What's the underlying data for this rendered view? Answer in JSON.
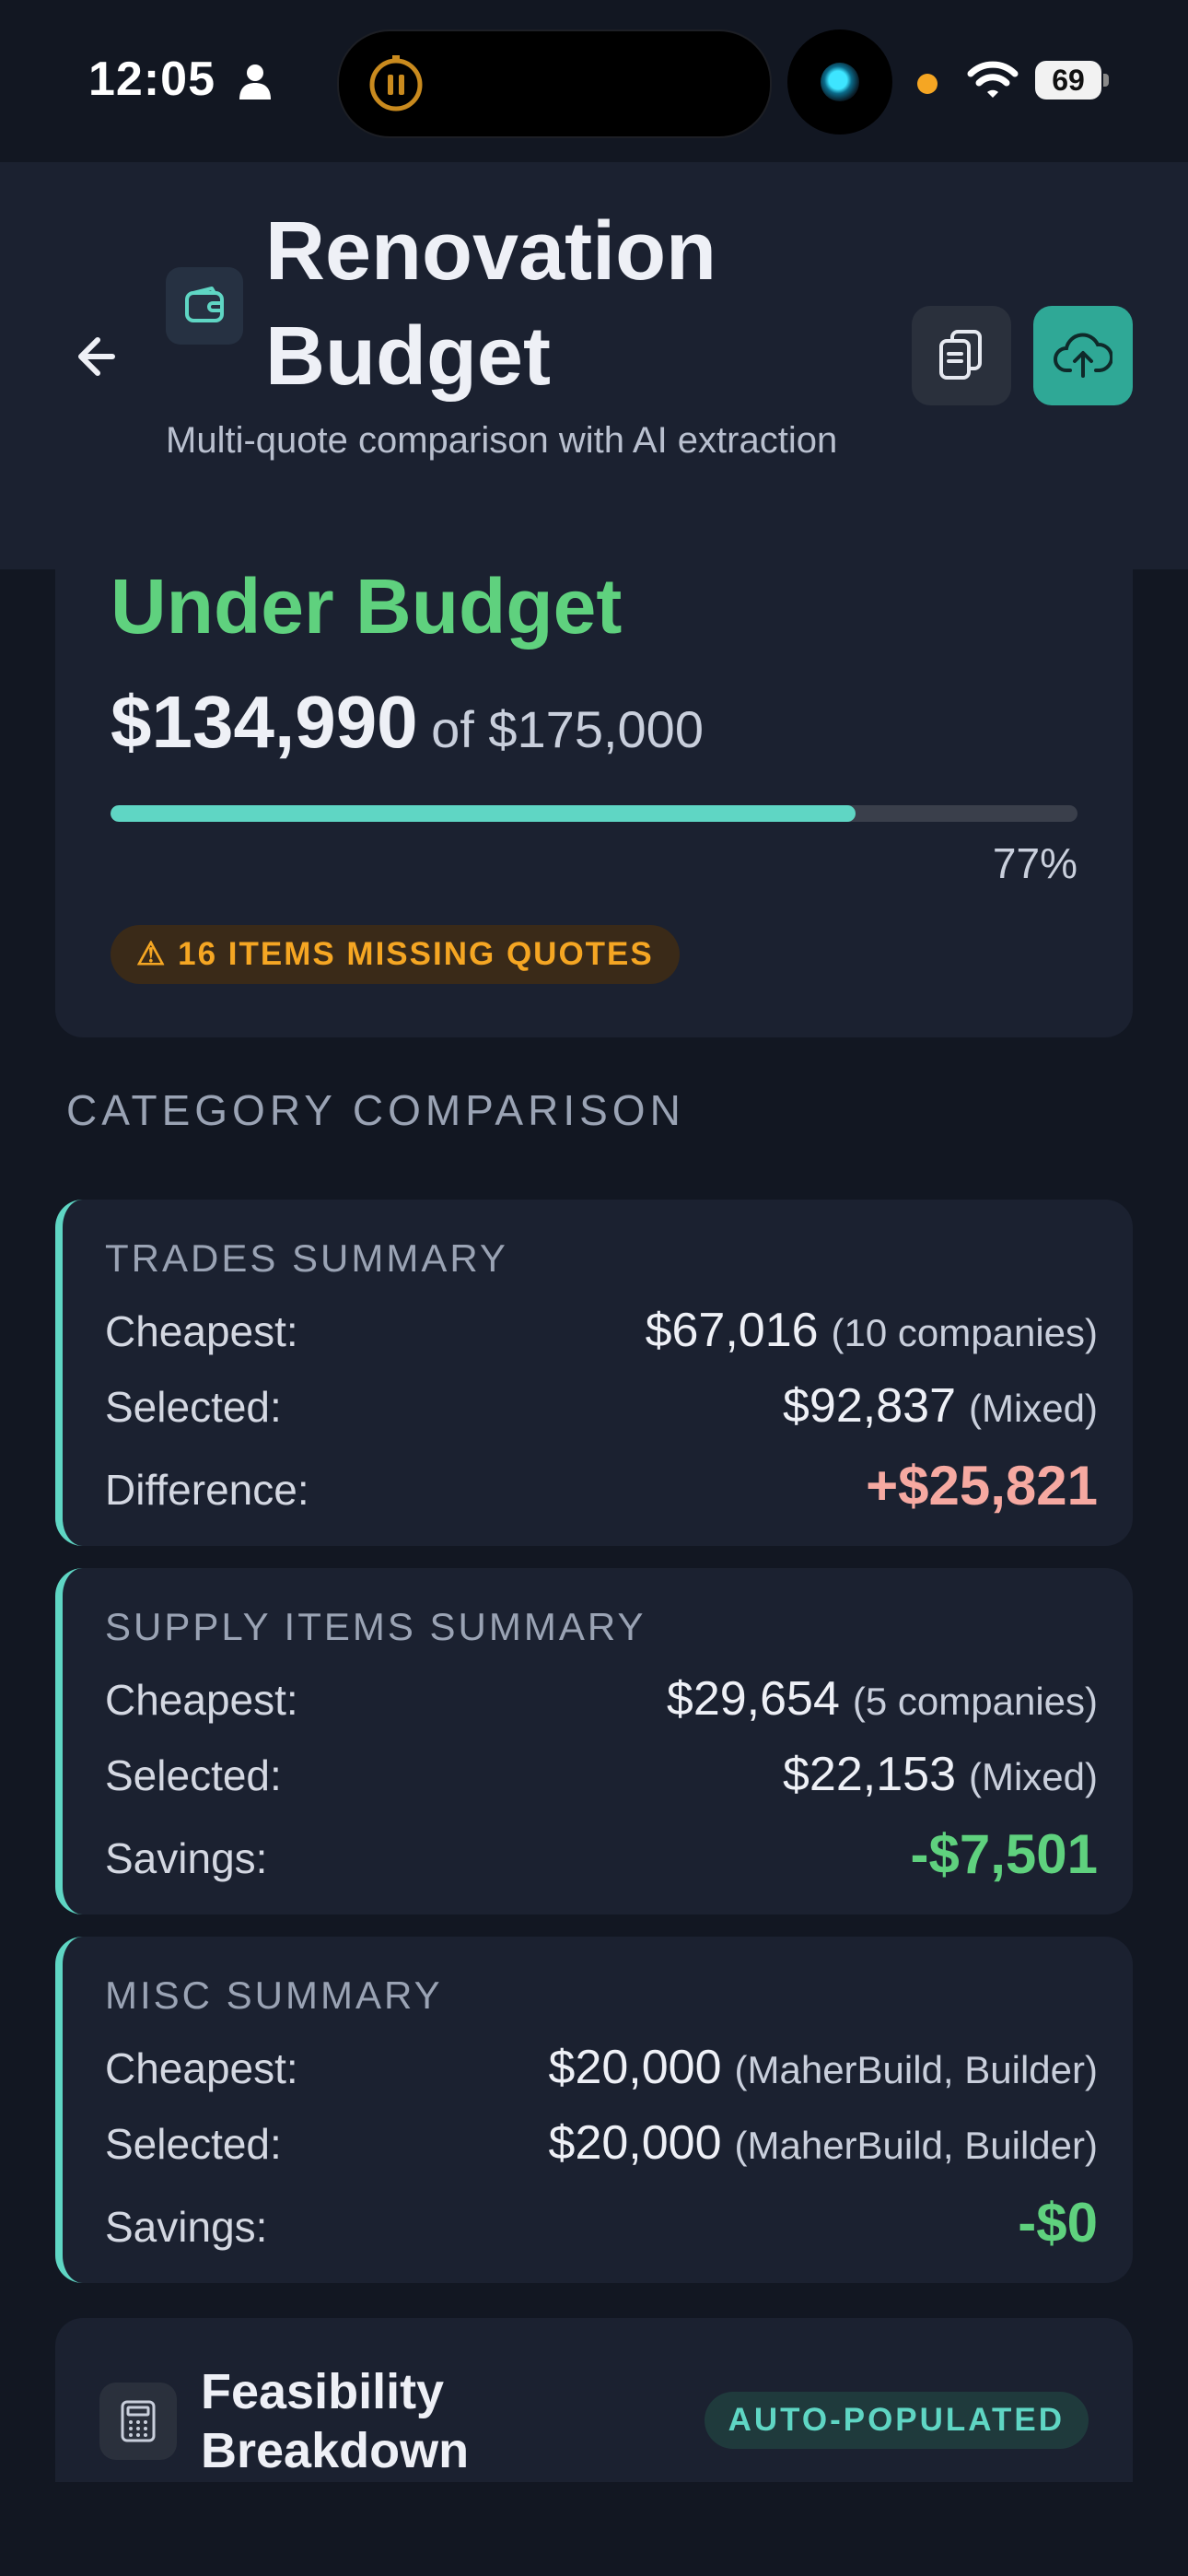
{
  "status_bar": {
    "time": "12:05",
    "battery": "69"
  },
  "header": {
    "title": "Renovation Budget",
    "subtitle": "Multi-quote comparison with AI extraction"
  },
  "budget": {
    "status": "Under Budget",
    "spent": "$134,990",
    "total": "of $175,000",
    "percent_label": "77%",
    "progress": 0.77,
    "missing_badge": "⚠ 16 ITEMS MISSING QUOTES"
  },
  "section_title": "CATEGORY COMPARISON",
  "summaries": [
    {
      "title": "TRADES SUMMARY",
      "rows": [
        {
          "label": "Cheapest:",
          "value": "$67,016",
          "note": "(10 companies)"
        },
        {
          "label": "Selected:",
          "value": "$92,837",
          "note": "(Mixed)"
        },
        {
          "label": "Difference:",
          "value": "+$25,821"
        }
      ]
    },
    {
      "title": "SUPPLY ITEMS SUMMARY",
      "rows": [
        {
          "label": "Cheapest:",
          "value": "$29,654",
          "note": "(5 companies)"
        },
        {
          "label": "Selected:",
          "value": "$22,153",
          "note": "(Mixed)"
        },
        {
          "label": "Savings:",
          "value": "-$7,501"
        }
      ]
    },
    {
      "title": "MISC SUMMARY",
      "rows": [
        {
          "label": "Cheapest:",
          "value": "$20,000",
          "note": "(MaherBuild, Builder)"
        },
        {
          "label": "Selected:",
          "value": "$20,000",
          "note": "(MaherBuild, Builder)"
        },
        {
          "label": "Savings:",
          "value": "-$0"
        }
      ]
    }
  ],
  "feasibility": {
    "title": "Feasibility Breakdown",
    "badge": "AUTO-POPULATED"
  },
  "colors": {
    "accent": "#5fd6c4",
    "positive": "#5fd17e",
    "negative": "#f6a9a1",
    "warning": "#f5a623"
  }
}
